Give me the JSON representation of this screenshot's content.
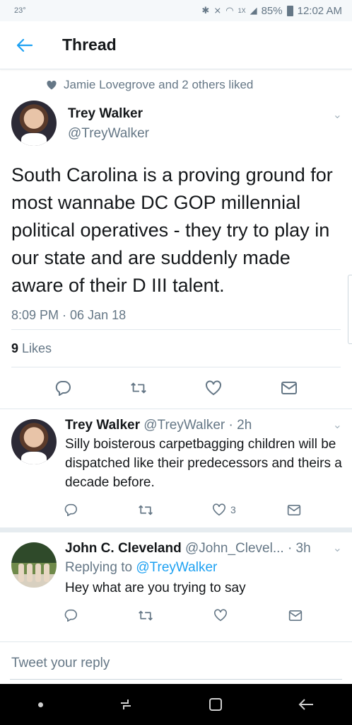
{
  "status": {
    "temp": "23°",
    "signal_label": "1X",
    "battery": "85%",
    "time": "12:02 AM"
  },
  "header": {
    "title": "Thread"
  },
  "social_context": "Jamie Lovegrove and 2 others liked",
  "main_tweet": {
    "name": "Trey Walker",
    "handle": "@TreyWalker",
    "text": "South Carolina is a proving ground for most wannabe DC GOP millennial political operatives - they try to play in our state and are suddenly made aware of their D III talent.",
    "timestamp": "8:09 PM · 06 Jan 18",
    "likes_count": "9",
    "likes_label": "Likes"
  },
  "replies": [
    {
      "name": "Trey Walker",
      "meta": "@TreyWalker · 2h",
      "text": "Silly boisterous carpetbagging children will be dispatched like their predecessors and theirs a decade before.",
      "like_count": "3"
    },
    {
      "name": "John C. Cleveland",
      "meta": "@John_Clevel... · 3h",
      "replying_prefix": "Replying to",
      "replying_to": "@TreyWalker",
      "text": "Hey what are you trying to say"
    }
  ],
  "compose": {
    "placeholder": "Tweet your reply"
  }
}
